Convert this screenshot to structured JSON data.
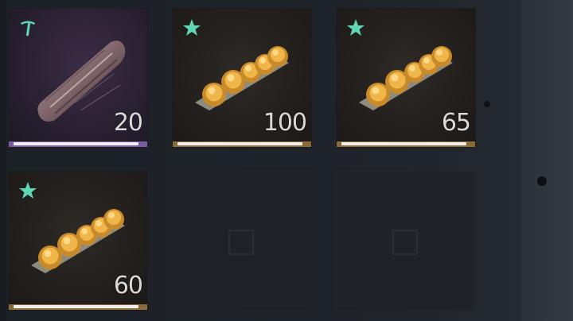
{
  "inventory": {
    "slots": [
      {
        "item": "wood-log",
        "badge": "pickaxe-icon",
        "count": "20",
        "durability": 0.96,
        "rarity_color": "#7a5aa0"
      },
      {
        "item": "bread-rolls",
        "badge": "star-icon",
        "count": "100",
        "durability": 0.96,
        "rarity_color": "#8a6a3a"
      },
      {
        "item": "bread-rolls",
        "badge": "star-icon",
        "count": "65",
        "durability": 0.96,
        "rarity_color": "#8a6a3a"
      },
      {
        "item": "bread-rolls",
        "badge": "star-icon",
        "count": "60",
        "durability": 0.96,
        "rarity_color": "#8a6a3a"
      },
      {
        "item": "empty"
      },
      {
        "item": "empty"
      }
    ]
  },
  "colors": {
    "badge": "#5fd7b4",
    "bar_fill": "#f2f0ec",
    "count_text": "#d9d9d9"
  }
}
